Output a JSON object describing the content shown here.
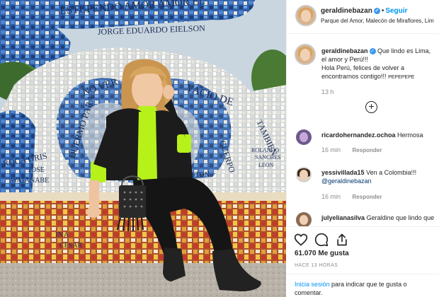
{
  "post": {
    "username": "geraldinebazan",
    "follow_label": "Seguir",
    "location": "Parque del Amor, Malecón de Miraflores, Lim",
    "caption_user": "geraldinebazan",
    "caption_line1": "Que lindo es Lima,",
    "caption_line2": "el amor y Perú!!!",
    "caption_line3": "Hola Perú, felices de volver a",
    "caption_line4": "encontrarnos contigo!!!",
    "caption_tail": "PEPEPEPE",
    "caption_time": "13 h",
    "likes": "61.070 Me gusta",
    "ago": "HACE 13 HORAS",
    "login_prompt_link": "Inicia sesión",
    "login_prompt_text": "para indicar que te gusta o",
    "login_prompt_text2": "comentar."
  },
  "comments": [
    {
      "user": "ricardohernandez.ochoa",
      "text": "Hermosa",
      "time": "16 min",
      "reply": "Responder"
    },
    {
      "user": "yessivillada15",
      "text": "Ven a Colombia!!!",
      "mention": "@geraldinebazan",
      "time": "16 min",
      "reply": "Responder"
    },
    {
      "user": "julyelianasilva",
      "text": "Geraldine que lindo que"
    }
  ],
  "photo_mural": {
    "top_text": "ESTUPENDO AMOR AMOR EL",
    "name_text": "JORGE EDUARDO EIELSON",
    "left_text1": "NO VER",
    "left_text2": "VACIO DE",
    "left_text3": "DUERMO PARA",
    "right_text1": "TAMBIEN",
    "right_text2": "CUERPO",
    "bottom_left1": "ROCA GRIS",
    "bottom_left2": "JOSE",
    "bottom_left3": "WATANABE",
    "bottom_mid1": "INA",
    "bottom_mid2": "CESAR",
    "bottom_right1": "ROLANDO",
    "bottom_right2": "SANCHES",
    "bottom_right3": "LEON",
    "bottom_right4": "STON"
  },
  "icons": {
    "heart": "heart-icon",
    "comment": "comment-icon",
    "share": "share-icon",
    "bookmark": "bookmark-icon",
    "plus": "plus-circle-icon",
    "verified": "verified-badge-icon"
  },
  "colors": {
    "accent_blue": "#0095f6",
    "text": "#262626",
    "muted": "#8e8e8e"
  }
}
